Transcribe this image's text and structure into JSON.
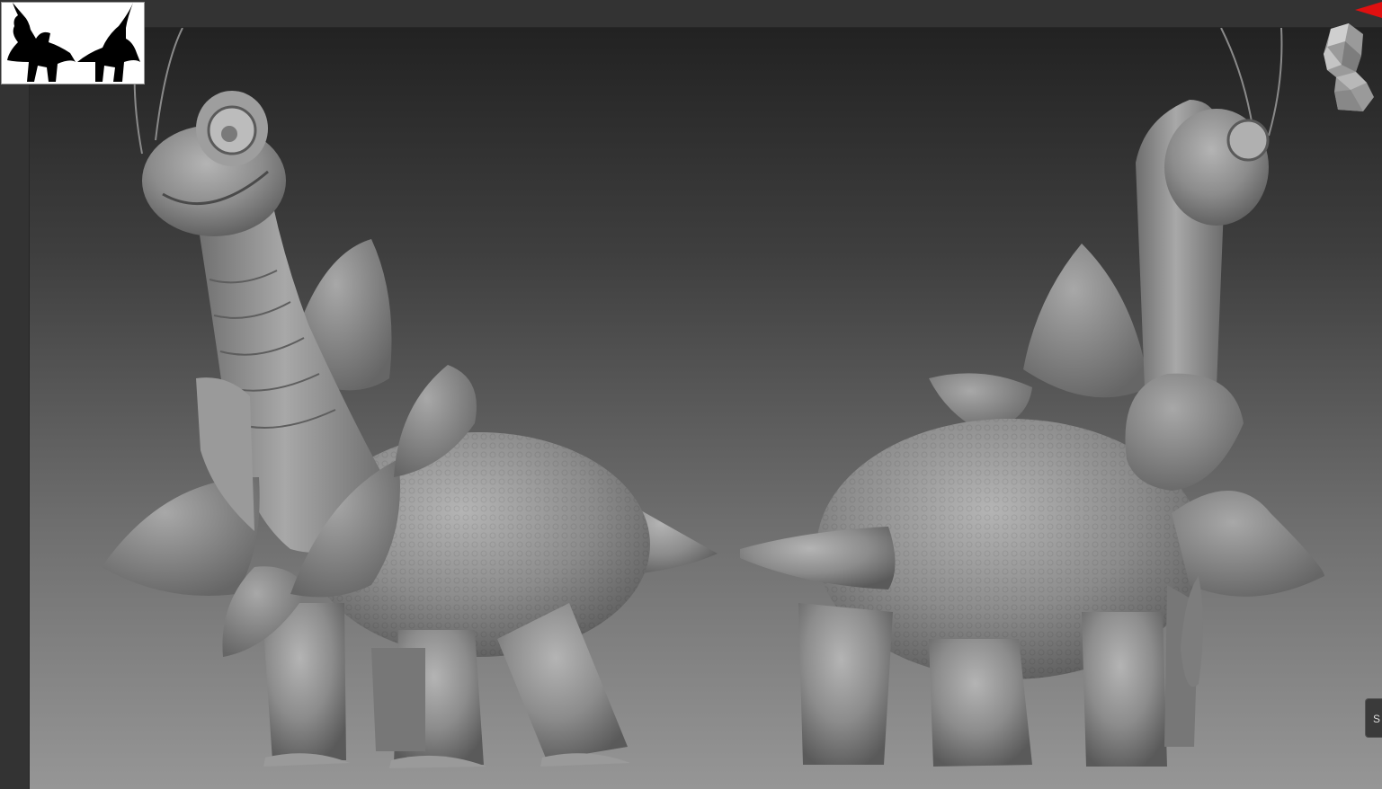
{
  "app": {
    "thumbnail_label": "",
    "side_tab_label": "S"
  },
  "colors": {
    "viewport_top": "#222222",
    "viewport_bottom": "#969696",
    "clay": "#8a8a8a",
    "marker": "#e01010"
  },
  "icons": {
    "navigator": "head-navigator-icon",
    "marker": "red-triangle-marker-icon"
  }
}
